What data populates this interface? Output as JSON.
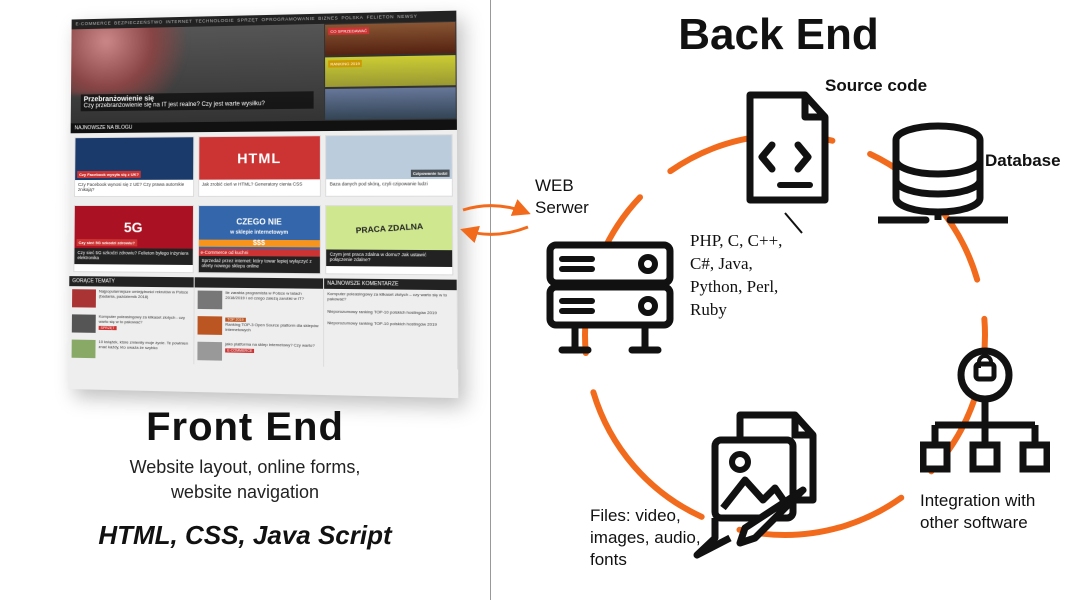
{
  "frontend": {
    "title": "Front End",
    "subtitle_line1": "Website layout, online forms,",
    "subtitle_line2": "website navigation",
    "tech": "HTML, CSS, Java Script",
    "mock_site": {
      "nav": [
        "E-COMMERCE",
        "BEZPIECZEŃSTWO",
        "INTERNET",
        "TECHNOLOGIE",
        "SPRZĘT",
        "OPROGRAMOWANIE",
        "BIZNES",
        "POLSKA",
        "FELIETON",
        "NEWSY"
      ],
      "hero_caption": "Przebranżowienie się",
      "hero_sub": "Czy przebranżowienie się na IT jest realne? Czy jest warte wysiłku?",
      "side1_tag": "CO SPRZEDAWAĆ",
      "side2_tag": "RANKING 2019",
      "bar": "NAJNOWSZE NA BLOGU",
      "row1": [
        {
          "thumb": "fb",
          "badge": "Czy Facebook wysyła się z UK?",
          "cap": "Czy Facebook wynosi się z UE? Czy prawa autorskie znikają?"
        },
        {
          "thumb": "html",
          "cap": "Jak zrobić cień w HTML? Generatory cienia CSS"
        },
        {
          "thumb": "robot",
          "overlay": "Czipowanie ludzi",
          "cap": "Baza danych pod skórą, czyli czipowanie ludzi"
        }
      ],
      "row2": [
        {
          "thumb": "5g",
          "text": "5G",
          "badge": "Czy sieć 5G szkodzi zdrowiu?",
          "cap": "Czy sieć 5G szkodzi zdrowiu? Felieton byłego inżyniera elektronika"
        },
        {
          "thumb": "shop",
          "line1": "CZEGO NIE",
          "line2": "w sklepie internetowym",
          "dollars": "$$$",
          "tag": "e-Commerce od kuchni",
          "cap": "Sprzedaż przez internet: który towar lepiej wyłączyć z oferty nowego sklepu online"
        },
        {
          "thumb": "work",
          "text": "PRACA ZDALNA",
          "cap": "Czym jest praca zdalna w domu? Jak ustawić połączenie zdalne?"
        }
      ],
      "cols": {
        "left_head": "GORĄCE TEMATY",
        "right_head": "NAJNOWSZE KOMENTARZE",
        "left": [
          "Najpopularniejsze umiejętności rekrutów w Polsce (badania, październik 2018)",
          "Komputer poleasingowy za kilkaset złotych - czy warto się w to pakować?",
          "10 książek, które zmieniły moje życie. Te powinien znać każdy, kto uważa że szybko"
        ],
        "mid": [
          "Ile zarabia programista w Polsce w latach 2018/2019 i od czego zależą zarobki w IT?",
          "Ranking TOP-3 Open Source platform dla sklepów internetowych",
          "jako platforma na sklep internetowy? Czy warto?"
        ],
        "right": [
          "Komputer poleasingowy za kilkaset złotych – czy warto się w to pakować?",
          "Nieporozumowy ranking TOP-10 polskich hostingów 2019",
          "Nieporozumowy ranking TOP-10 polskich hostingów 2019"
        ],
        "tag_sprzet": "SPRZĘT",
        "tag_ecom": "E-COMMERCE",
        "tag_top": "TOP 2019"
      }
    }
  },
  "backend": {
    "title": "Back End",
    "nodes": {
      "source_code": "Source code",
      "database": "Database",
      "web_server_l1": "WEB",
      "web_server_l2": "Serwer",
      "integration_l1": "Integration with",
      "integration_l2": "other software",
      "files_l1": "Files: video,",
      "files_l2": "images, audio,",
      "files_l3": "fonts"
    },
    "languages_l1": "PHP, C, C++,",
    "languages_l2": "C#, Java,",
    "languages_l3": "Python, Perl,",
    "languages_l4": "Ruby"
  }
}
